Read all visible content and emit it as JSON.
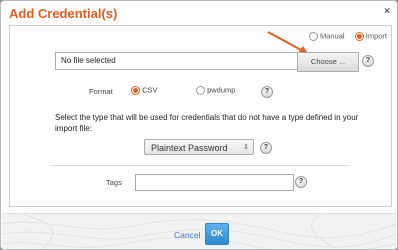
{
  "dialog": {
    "title": "Add Credential(s)",
    "close_glyph": "×"
  },
  "mode": {
    "options": [
      {
        "label": "Manual",
        "selected": false
      },
      {
        "label": "Import",
        "selected": true
      }
    ]
  },
  "file": {
    "value": "No file selected",
    "choose_label": "Choose ..."
  },
  "format": {
    "label": "Format",
    "options": [
      {
        "label": "CSV",
        "selected": true
      },
      {
        "label": "pwdump",
        "selected": false
      }
    ]
  },
  "type_section": {
    "description": "Select the type that will be used for credentials that do not have a type defined in your import file:",
    "selected": "Plaintext Password",
    "caret": "⇕"
  },
  "tags": {
    "label": "Tags",
    "value": ""
  },
  "help_glyph": "?",
  "footer": {
    "cancel_label": "Cancel",
    "ok_label": "OK"
  },
  "colors": {
    "accent": "#e35d1e",
    "link": "#3a77c2",
    "primary_button": "#2e8ad0"
  },
  "icons": [
    "close-icon",
    "help-icon",
    "arrow-annotation-icon",
    "radio-icon",
    "select-caret-icon"
  ]
}
